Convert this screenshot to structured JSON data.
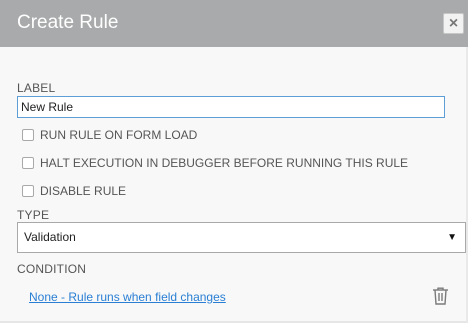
{
  "dialog": {
    "title": "Create Rule",
    "close_label": "×"
  },
  "form": {
    "label_heading": "LABEL",
    "label_value": "New Rule",
    "checkboxes": [
      {
        "label": "RUN RULE ON FORM LOAD",
        "checked": false
      },
      {
        "label": "HALT EXECUTION IN DEBUGGER BEFORE RUNNING THIS RULE",
        "checked": false
      },
      {
        "label": "DISABLE RULE",
        "checked": false
      }
    ],
    "type_heading": "TYPE",
    "type_value": "Validation",
    "type_arrow": "▼",
    "condition_heading": "CONDITION",
    "condition_link": "None - Rule runs when field changes",
    "delete_icon": "trash-icon"
  }
}
